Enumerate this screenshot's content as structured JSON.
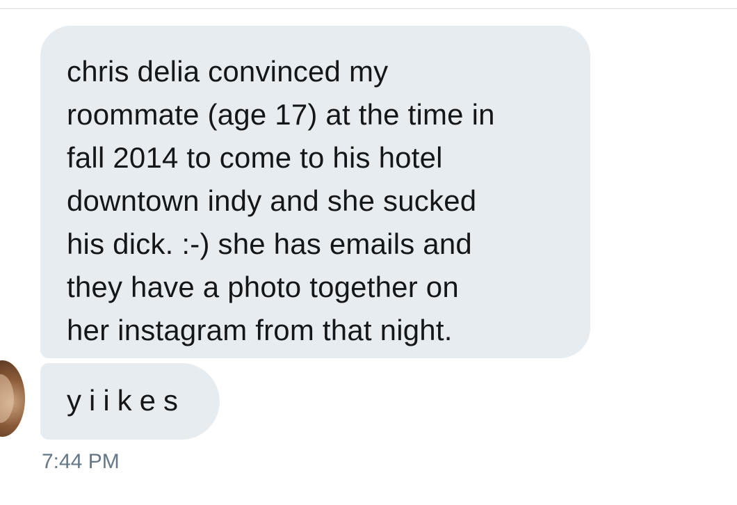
{
  "messages": [
    {
      "text": "chris delia convinced my\nroommate (age 17) at the time in\nfall 2014 to come to his hotel\ndowntown indy and she sucked\nhis dick. :-) she has emails and\nthey have a photo together on\nher instagram from that night."
    },
    {
      "text": "yiikes"
    }
  ],
  "timestamp": "7:44 PM",
  "colors": {
    "bubble_background": "#e6ecf0",
    "text": "#14171a",
    "timestamp": "#657786"
  }
}
